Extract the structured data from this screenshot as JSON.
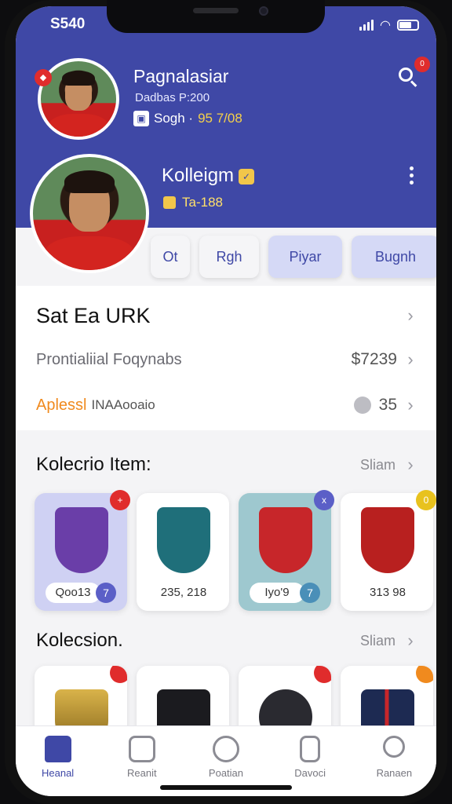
{
  "status": {
    "time": "S540"
  },
  "profile_top": {
    "name": "Pagnalasiar",
    "subtitle": "Dadbas P:200",
    "stat_label": "Sogh ·",
    "stat_value": "95 7/08",
    "notification_count": "0"
  },
  "profile_main": {
    "name": "Kolleigm",
    "stat": "Ta-188"
  },
  "tabs": [
    {
      "label": "Ot"
    },
    {
      "label": "Rgh"
    },
    {
      "label": "Piyar"
    },
    {
      "label": "Bugnh"
    }
  ],
  "list": {
    "title": "Sat Ea URK",
    "row2_label": "Prontialiial Foqynabs",
    "row2_value": "$7239",
    "row3_label_a": "Aplessl",
    "row3_label_b": "INAAooaio",
    "row3_value": "35"
  },
  "section1": {
    "title": "Kolecrio Item:",
    "more": "Sliam",
    "cards": [
      {
        "label": "Qoo13",
        "badge": "7",
        "corner": "+"
      },
      {
        "label": "235, 218",
        "corner": ""
      },
      {
        "label": "Iyo'9",
        "badge": "7",
        "corner": "x"
      },
      {
        "label": "313 98",
        "corner": "0"
      }
    ]
  },
  "section2": {
    "title": "Kolecsion.",
    "more": "Sliam"
  },
  "nav": [
    {
      "label": "Heanal"
    },
    {
      "label": "Reanit"
    },
    {
      "label": "Poatian"
    },
    {
      "label": "Davoci"
    },
    {
      "label": "Ranaen"
    }
  ],
  "colors": {
    "primary": "#3f48a6",
    "accent_orange": "#f08a1e",
    "badge_red": "#e02c2c"
  }
}
